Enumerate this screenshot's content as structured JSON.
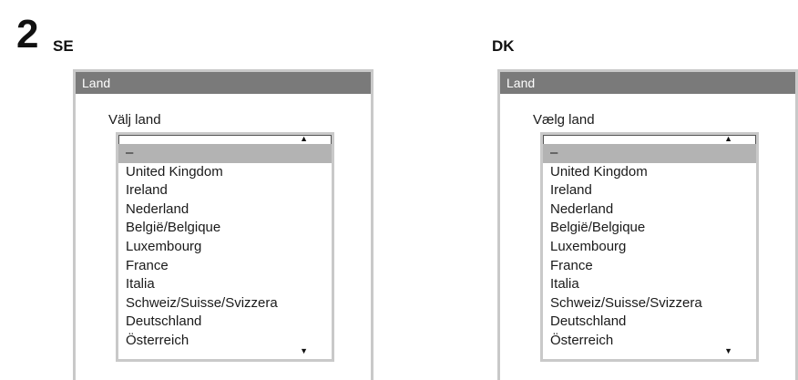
{
  "step": "2",
  "panels": [
    {
      "code": "SE",
      "header": "Land",
      "label": "Välj land",
      "items": [
        "–",
        "United Kingdom",
        "Ireland",
        "Nederland",
        "België/Belgique",
        "Luxembourg",
        "France",
        "Italia",
        "Schweiz/Suisse/Svizzera",
        "Deutschland",
        "Österreich"
      ]
    },
    {
      "code": "DK",
      "header": "Land",
      "label": "Vælg land",
      "items": [
        "–",
        "United Kingdom",
        "Ireland",
        "Nederland",
        "België/Belgique",
        "Luxembourg",
        "France",
        "Italia",
        "Schweiz/Suisse/Svizzera",
        "Deutschland",
        "Österreich"
      ]
    }
  ],
  "icons": {
    "scroll_up": "scroll-up-arrow-icon",
    "scroll_down": "scroll-down-arrow-icon"
  },
  "colors": {
    "header_bg": "#7a7a7a",
    "selected_bg": "#b3b3b3",
    "frame": "#c9c9c9"
  }
}
